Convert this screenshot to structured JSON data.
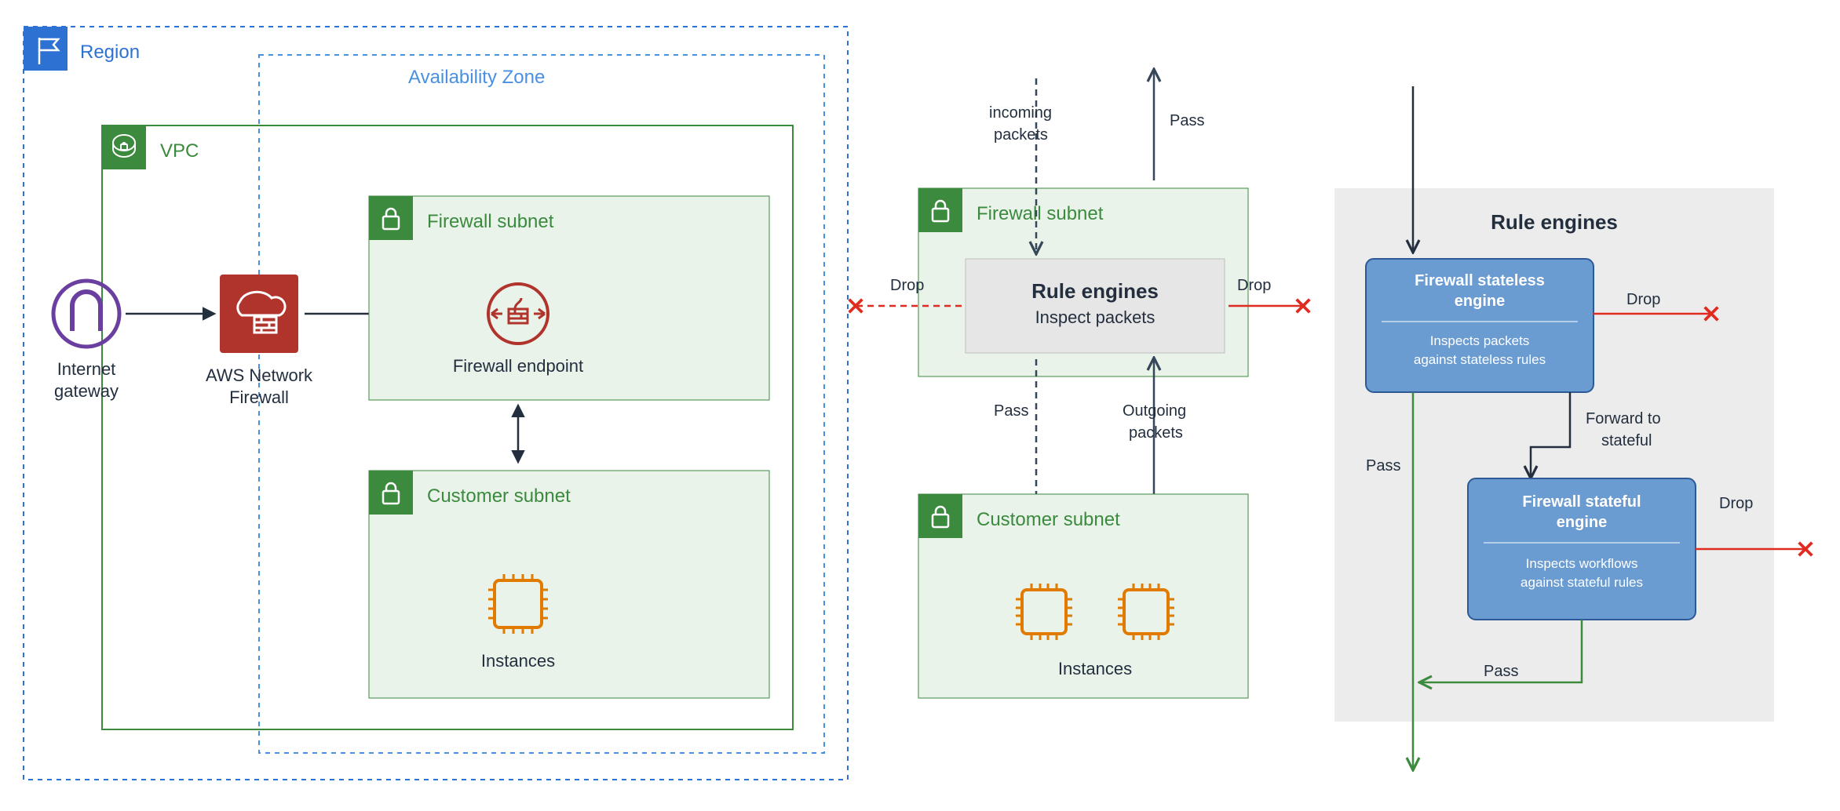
{
  "region": {
    "label": "Region"
  },
  "availability_zone": {
    "label": "Availability Zone"
  },
  "vpc": {
    "label": "VPC"
  },
  "igw": {
    "label1": "Internet",
    "label2": "gateway"
  },
  "nfw": {
    "label1": "AWS Network",
    "label2": "Firewall"
  },
  "firewall_subnet": {
    "title": "Firewall subnet",
    "endpoint_label": "Firewall endpoint"
  },
  "customer_subnet": {
    "title": "Customer subnet",
    "instances_label": "Instances"
  },
  "flow": {
    "firewall_subnet_title": "Firewall subnet",
    "customer_subnet_title": "Customer subnet",
    "rule_box_title": "Rule engines",
    "rule_box_sub": "Inspect packets",
    "incoming": "incoming\npackets",
    "outgoing": "Outgoing\npackets",
    "pass_top": "Pass",
    "pass_down": "Pass",
    "drop_left": "Drop",
    "drop_right": "Drop",
    "instances_label": "Instances"
  },
  "rule_engines": {
    "title": "Rule engines",
    "stateless": {
      "title": "Firewall stateless\nengine",
      "sub": "Inspects packets\nagainst stateless rules"
    },
    "stateful": {
      "title": "Firewall stateful\nengine",
      "sub": "Inspects workflows\nagainst stateful rules"
    },
    "drop1": "Drop",
    "drop2": "Drop",
    "forward": "Forward to\nstateful",
    "pass1": "Pass",
    "pass2": "Pass"
  }
}
